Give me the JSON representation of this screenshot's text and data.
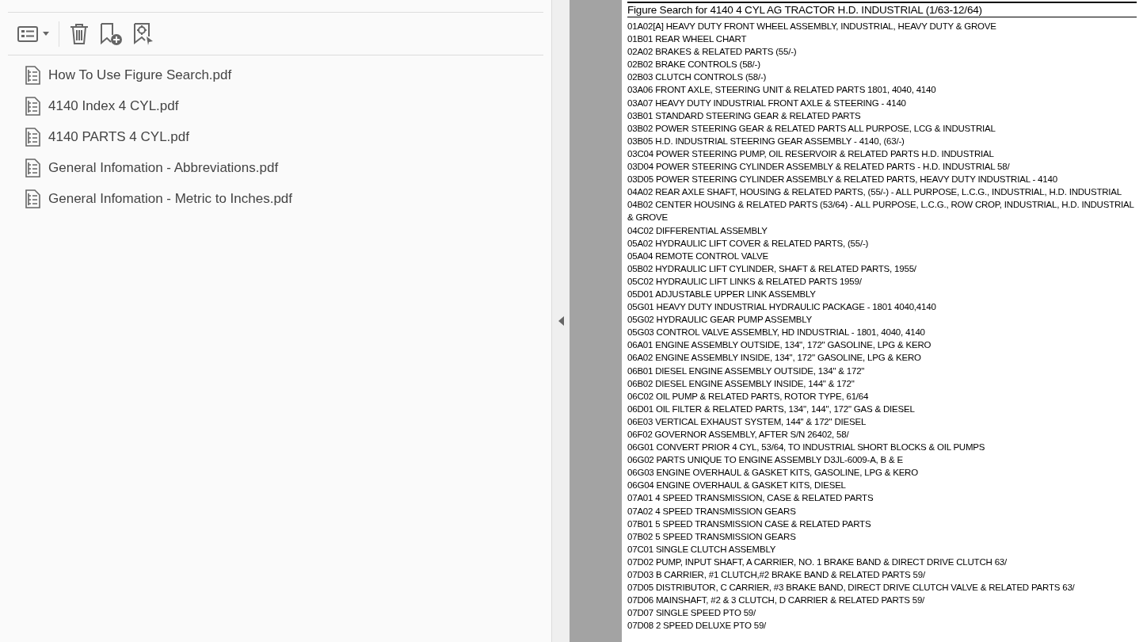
{
  "files": [
    {
      "name": "How To Use Figure Search.pdf"
    },
    {
      "name": "4140 Index 4 CYL.pdf"
    },
    {
      "name": "4140 PARTS 4 CYL.pdf"
    },
    {
      "name": "General Infomation - Abbreviations.pdf"
    },
    {
      "name": "General Infomation - Metric to Inches.pdf"
    }
  ],
  "document": {
    "title": "Figure Search for 4140 4 CYL AG TRACTOR H.D. INDUSTRIAL (1/63-12/64)",
    "entries": [
      "01A02[A] HEAVY DUTY FRONT WHEEL ASSEMBLY, INDUSTRIAL, HEAVY DUTY & GROVE",
      "01B01 REAR WHEEL CHART",
      "02A02 BRAKES & RELATED PARTS (55/-)",
      "02B02 BRAKE CONTROLS (58/-)",
      "02B03 CLUTCH CONTROLS (58/-)",
      "03A06 FRONT AXLE, STEERING UNIT & RELATED PARTS 1801, 4040, 4140",
      "03A07 HEAVY DUTY INDUSTRIAL FRONT AXLE & STEERING - 4140",
      "03B01 STANDARD STEERING GEAR & RELATED PARTS",
      "03B02 POWER STEERING GEAR & RELATED PARTS ALL PURPOSE, LCG & INDUSTRIAL",
      "03B05 H.D. INDUSTRIAL STEERING GEAR ASSEMBLY - 4140, (63/-)",
      "03C04 POWER STEERING PUMP, OIL RESERVOIR & RELATED PARTS H.D. INDUSTRIAL",
      "03D04 POWER STEERING CYLINDER ASSEMBLY & RELATED PARTS - H.D. INDUSTRIAL 58/",
      "03D05 POWER STEERING CYLINDER ASSEMBLY & RELATED PARTS, HEAVY DUTY INDUSTRIAL - 4140",
      "04A02 REAR AXLE SHAFT, HOUSING & RELATED PARTS, (55/-) - ALL PURPOSE, L.C.G., INDUSTRIAL, H.D. INDUSTRIAL",
      "04B02 CENTER HOUSING & RELATED PARTS (53/64) - ALL PURPOSE, L.C.G., ROW CROP, INDUSTRIAL, H.D. INDUSTRIAL & GROVE",
      "04C02 DIFFERENTIAL ASSEMBLY",
      "05A02 HYDRAULIC LIFT COVER & RELATED PARTS, (55/-)",
      "05A04 REMOTE CONTROL VALVE",
      "05B02 HYDRAULIC LIFT CYLINDER, SHAFT & RELATED PARTS, 1955/",
      "05C02 HYDRAULIC LIFT LINKS & RELATED PARTS 1959/",
      "05D01 ADJUSTABLE UPPER LINK ASSEMBLY",
      "05G01 HEAVY DUTY INDUSTRIAL HYDRAULIC PACKAGE - 1801 4040,4140",
      "05G02 HYDRAULIC GEAR PUMP ASSEMBLY",
      "05G03 CONTROL VALVE ASSEMBLY, HD INDUSTRIAL - 1801, 4040, 4140",
      "06A01 ENGINE ASSEMBLY OUTSIDE, 134\", 172\" GASOLINE, LPG & KERO",
      "06A02 ENGINE ASSEMBLY INSIDE, 134\", 172\" GASOLINE, LPG & KERO",
      "06B01 DIESEL ENGINE ASSEMBLY OUTSIDE, 134\" & 172\"",
      "06B02 DIESEL ENGINE ASSEMBLY INSIDE, 144\" & 172\"",
      "06C02 OIL PUMP & RELATED PARTS, ROTOR TYPE, 61/64",
      "06D01 OIL FILTER & RELATED PARTS, 134\", 144\", 172\" GAS & DIESEL",
      "06E03 VERTICAL EXHAUST SYSTEM, 144\" & 172\" DIESEL",
      "06F02 GOVERNOR ASSEMBLY, AFTER S/N 26402, 58/",
      "06G01 CONVERT PRIOR 4 CYL, 53/64, TO INDUSTRIAL SHORT BLOCKS & OIL PUMPS",
      "06G02 PARTS UNIQUE TO ENGINE ASSEMBLY D3JL-6009-A, B & E",
      "06G03 ENGINE OVERHAUL & GASKET KITS, GASOLINE, LPG & KERO",
      "06G04 ENGINE OVERHAUL & GASKET KITS, DIESEL",
      "07A01 4 SPEED TRANSMISSION, CASE & RELATED PARTS",
      "07A02 4 SPEED TRANSMISSION GEARS",
      "07B01 5 SPEED TRANSMISSION CASE & RELATED PARTS",
      "07B02 5 SPEED TRANSMISSION GEARS",
      "07C01 SINGLE CLUTCH ASSEMBLY",
      "07D02 PUMP, INPUT SHAFT, A CARRIER, NO. 1 BRAKE BAND & DIRECT DRIVE CLUTCH 63/",
      "07D03 B CARRIER, #1 CLUTCH,#2 BRAKE BAND & RELATED PARTS 59/",
      "07D05 DISTRIBUTOR, C CARRIER, #3 BRAKE BAND, DIRECT DRIVE CLUTCH VALVE & RELATED PARTS 63/",
      "07D06 MAINSHAFT, #2 & 3 CLUTCH, D CARRIER & RELATED PARTS 59/",
      "07D07 SINGLE SPEED PTO 59/",
      "07D08 2 SPEED DELUXE PTO 59/"
    ]
  }
}
